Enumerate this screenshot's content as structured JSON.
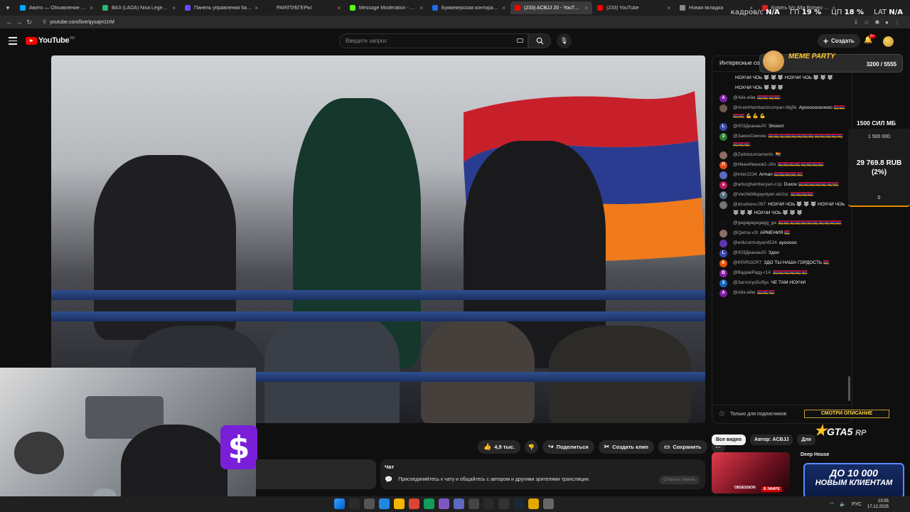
{
  "browser": {
    "tabs": [
      {
        "title": "Авито — Объявление на сайте",
        "color": "#00aaff",
        "active": false
      },
      {
        "title": "ВАЗ (LADA) Niva Legend Sport",
        "color": "#2bb673",
        "active": false
      },
      {
        "title": "Панель управления баттоном",
        "color": "#6c47ff",
        "active": false
      },
      {
        "title": "PARIПУБГЕРЫ",
        "color": "#1d1d1d",
        "active": false
      },
      {
        "title": "Message Moderation - Kick",
        "color": "#53fc18",
        "active": false
      },
      {
        "title": "Букмекерская контора Betboom",
        "color": "#1a6fe6",
        "active": false
      },
      {
        "title": "(233) ACBJJ 20 - YouTube",
        "color": "#ff0000",
        "active": true
      },
      {
        "title": "(233) YouTube",
        "color": "#ff0000",
        "active": false
      },
      {
        "title": "Новая вкладка",
        "color": "#888888",
        "active": false
      },
      {
        "title": "Купить б/у Alfa Romeo Giulia",
        "color": "#d62027",
        "active": false
      }
    ],
    "url": "youtube.com/live/qysajm1IrM"
  },
  "stats": {
    "fps_label": "кадров/с",
    "fps_value": "N/A",
    "gpu_label": "ГП",
    "gpu_value": "19 %",
    "cpu_label": "ЦП",
    "cpu_value": "18 %",
    "lat_label": "LAT",
    "lat_value": "N/A"
  },
  "youtube": {
    "logo_text": "YouTube",
    "logo_region": "RU",
    "search_placeholder": "Введите запрос",
    "create_label": "Создать",
    "notif_count": "9+"
  },
  "actions": {
    "likes": "4,9 тыс.",
    "share": "Поделиться",
    "clip": "Создать клип",
    "save": "Сохранить"
  },
  "chat_prompt": {
    "title": "Чат",
    "text": "Присоединяйтесь к чату и общайтесь с автором и другими зрителями трансляции.",
    "button": "Открыть панель"
  },
  "chat": {
    "header": "Интересные сообщения",
    "footer": "Только для подписчиков",
    "messages": [
      {
        "author": "",
        "text": "НОХЧИ ЧОЬ 🐺 🐺 🐺 НОХЧИ ЧОЬ 🐺 🐺 🐺",
        "color": "#0f0f0f",
        "initial": ""
      },
      {
        "author": "",
        "text": "НОХЧИ ЧОЬ 🐺 🐺 🐺",
        "color": "#0f0f0f",
        "initial": ""
      },
      {
        "author": "@Айк-ийм",
        "text": "🇦🇲🇦🇲🇦🇲🇦🇲",
        "color": "#7b1fa2",
        "initial": "А"
      },
      {
        "author": "@AramHambardzumyan-t9g5k",
        "text": "Ауооооооооооо 🇦🇲🇦🇲🇦🇲🇦🇲 💪 💪 💪",
        "color": "#6d5c4a",
        "initial": ""
      },
      {
        "author": "@003Дианаь00",
        "text": "Элооот",
        "color": "#3949ab",
        "initial": "L"
      },
      {
        "author": "@ЗакенСмкчян",
        "text": "🇦🇲🇦🇲🇦🇲🇦🇲🇦🇲🇦🇲🇦🇲🇦🇲🇦🇲🇦🇲🇦🇲🇦🇲🇦🇲🇦🇲🇦🇲🇦🇲",
        "color": "#2e7d32",
        "initial": "З"
      },
      {
        "author": "@Zeitstournaments",
        "text": "🏳️‍🌈",
        "color": "#8d6e63",
        "initial": ""
      },
      {
        "author": "@ИванИванов1-з5я",
        "text": "🇦🇲🇦🇲🇦🇲🇦🇲🇦🇲🇦🇲🇦🇲🇦🇲",
        "color": "#e64a19",
        "initial": "П"
      },
      {
        "author": "@inter2234",
        "text": "Arman 🇦🇲🇦🇲🇦🇲🇦🇲🇦🇲",
        "color": "#5c6bc0",
        "initial": ""
      },
      {
        "author": "@arturghambaryan-c1p",
        "text": "Duxov 🇦🇲🇦🇲🇦🇲🇦🇲🇦🇲🇦🇲🇦🇲",
        "color": "#c2185b",
        "initial": "a"
      },
      {
        "author": "@VachikMiqayelyan-ek2oc",
        "text": "🇦🇲🇦🇲🇦🇲🇦🇲",
        "color": "#546e7a",
        "initial": "V"
      },
      {
        "author": "@dzudsevv.097",
        "text": "НОХЧИ ЧОЬ 🐺 🐺 🐺 НОХЧИ ЧОЬ 🐺 🐺 🐺 НОХЧИ ЧОЬ 🐺 🐺 🐺",
        "color": "#757575",
        "initial": ""
      },
      {
        "author": "@gagagagagagg_ga",
        "text": "🇦🇲🇦🇲🇦🇲🇦🇲🇦🇲🇦🇲🇦🇲🇦🇲🇦🇲🇦🇲🇦🇲",
        "color": "#111111",
        "initial": ""
      },
      {
        "author": "@Qema-v3t",
        "text": "АРМЕНИЯ 🇦🇲",
        "color": "#8d6e63",
        "initial": ""
      },
      {
        "author": "@erikcormutyan4524",
        "text": "ауооооо",
        "color": "#5e35b1",
        "initial": ""
      },
      {
        "author": "@003Дианаь00",
        "text": "Здоо",
        "color": "#3949ab",
        "initial": "L"
      },
      {
        "author": "@KRIROCR7",
        "text": "ЗДО ТЫ НАША ГОРДОСТЬ 🇦🇲",
        "color": "#e65100",
        "initial": "K"
      },
      {
        "author": "@ВадимРаду-г1й",
        "text": "🇦🇲🇦🇲🇦🇲🇦🇲🇦🇲🇦🇲",
        "color": "#8e24aa",
        "initial": "В"
      },
      {
        "author": "@ЗаглогусБобус",
        "text": "ЧЕ ТАМ НОХЧИ",
        "color": "#1565c0",
        "initial": "З"
      },
      {
        "author": "@Айк-ийм",
        "text": "🇦🇲🇦🇲🇦🇲",
        "color": "#7b1fa2",
        "initial": "А"
      }
    ]
  },
  "goal": {
    "label": "1500 СИЛ МБ",
    "target": "1 500 000",
    "amount": "29 769.8 RUB",
    "percent": "(2%)",
    "min": "0",
    "progress_fraction": 0.02
  },
  "meme_party": {
    "title": "MEME PARTY",
    "score": "3200 / 5555"
  },
  "chips": [
    "Все видео",
    "Автор: ACBJJ",
    "Для"
  ],
  "recommendation": {
    "title": "Deep House",
    "thumb_text": "OBSESSION",
    "live_badge": "В ЭФИРЕ"
  },
  "promo": {
    "top": "СМОТРИ ОПИСАНИЕ",
    "gta": "GTA5",
    "rp": "RP",
    "line1": "ДО 10 000",
    "line2": "НОВЫМ КЛИЕНТАМ"
  },
  "webcam": {
    "logo_letter": "$"
  },
  "taskbar": {
    "lang": "РУС",
    "time": "23:55",
    "date": "17.12.2025"
  }
}
